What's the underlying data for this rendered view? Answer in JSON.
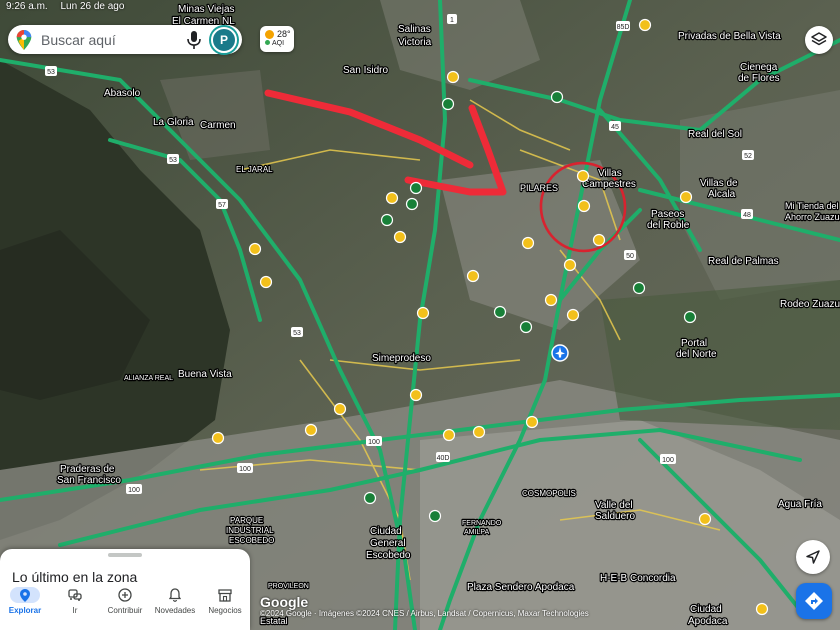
{
  "status_bar": {
    "time": "9:26 a.m.",
    "date": "Lun 26 de ago"
  },
  "search": {
    "placeholder": "Buscar aquí",
    "avatar_letter": "P"
  },
  "weather": {
    "temperature": "28°",
    "aqi_label": "AQI"
  },
  "colors": {
    "highway": "#1fae6a",
    "road": "#e6c94e",
    "annotation": "#ee2b38",
    "accent": "#1a73e8",
    "poi_green": "#188038",
    "poi_yellow": "#f2c01b"
  },
  "map": {
    "labels": {
      "minas_viejas": "Minas Viejas",
      "el_carmen": "El Carmen NL",
      "salinas_victoria": "Salinas Victoria",
      "privadas_bella_vista": "Privadas de Bella Vista",
      "cienega": "Cienega de Flores",
      "san_isidro": "San Isidro",
      "abasolo": "Abasolo",
      "la_gloria": "La Gloria",
      "carmen": "Carmen",
      "real_del_sol": "Real del Sol",
      "villas_campestres": "Villas Campestres",
      "pilares": "PILARES",
      "villas_alcala": "Villas de Alcala",
      "el_jaral": "EL JARAL",
      "paseos_roble": "Paseos del Roble",
      "mi_tienda": "Mi Tienda del Ahorro Zuazua",
      "real_palmas": "Real de Palmas",
      "rodeo_zuazua": "Rodeo Zuazua",
      "portal_norte": "Portal del Norte",
      "simeprodeso": "Simeprodeso",
      "buena_vista": "Buena Vista",
      "alianza_real": "ALIANZA REAL",
      "praderas": "Praderas de San Francisco",
      "cosmopolis": "COSMOPOLIS",
      "valle_salduero": "Valle del Salduero",
      "agua_fria": "Agua Fría",
      "parque_industrial": "PARQUE INDUSTRIAL ESCOBEDO",
      "fernando_amilpa": "FERNANDO AMILPA",
      "ciudad_escobedo": "Ciudad General Escobedo",
      "heb": "H-E-B Concordia",
      "provileon": "PROVILEON",
      "plaza_sendero": "Plaza Sendero Apodaca",
      "ciudad_apodaca": "Ciudad Apodaca",
      "estatal": "Estatal"
    },
    "road_shields": [
      "1",
      "85D",
      "53",
      "45",
      "57",
      "100",
      "52",
      "40D",
      "48",
      "50"
    ]
  },
  "bottom_sheet": {
    "title": "Lo último en la zona"
  },
  "nav": [
    {
      "label": "Explorar",
      "icon": "location-pin-icon"
    },
    {
      "label": "Ir",
      "icon": "commute-icon"
    },
    {
      "label": "Contribuir",
      "icon": "add-circle-icon"
    },
    {
      "label": "Novedades",
      "icon": "bell-icon"
    },
    {
      "label": "Negocios",
      "icon": "storefront-icon"
    }
  ],
  "attribution": {
    "logo": "Google",
    "copyright": "©2024 Google · Imágenes ©2024 CNES / Airbus, Landsat / Copernicus, Maxar Technologies"
  }
}
